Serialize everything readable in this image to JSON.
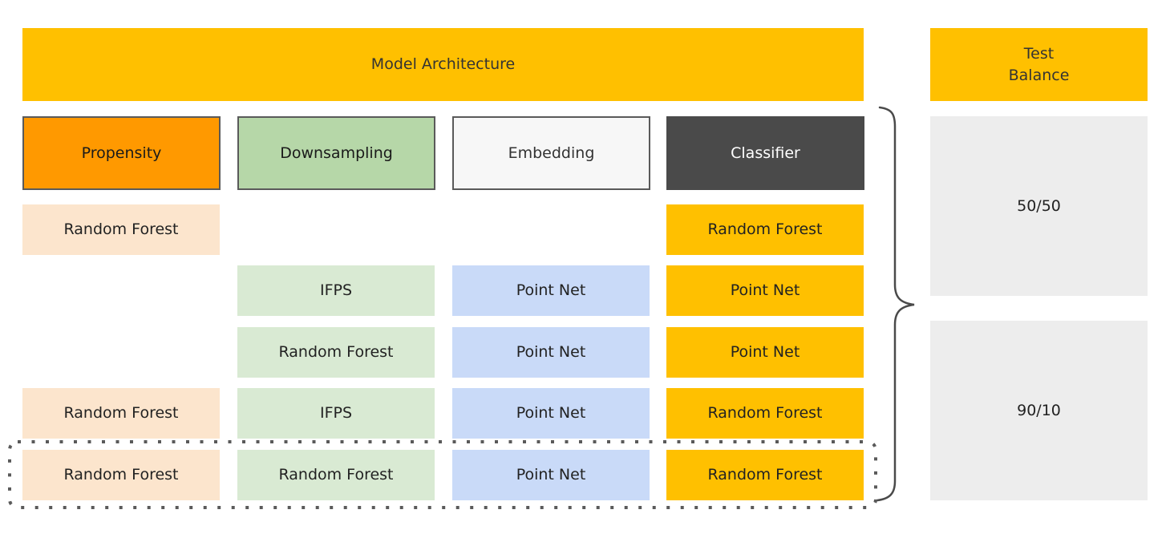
{
  "header": {
    "model_architecture": "Model Architecture",
    "test_balance": "Test\nBalance"
  },
  "columns": [
    {
      "key": "propensity",
      "label": "Propensity",
      "color": "#FF9900",
      "cell_color": "#FCE5CD"
    },
    {
      "key": "downsampling",
      "label": "Downsampling",
      "color": "#B6D7A8",
      "cell_color": "#D9EAD3"
    },
    {
      "key": "embedding",
      "label": "Embedding",
      "color": "#F7F7F7",
      "cell_color": "#C9DAF8"
    },
    {
      "key": "classifier",
      "label": "Classifier",
      "color": "#4A4A4A",
      "cell_color": "#FFC000"
    }
  ],
  "rows": [
    {
      "propensity": "Random Forest",
      "downsampling": "",
      "embedding": "",
      "classifier": "Random Forest"
    },
    {
      "propensity": "",
      "downsampling": "IFPS",
      "embedding": "Point Net",
      "classifier": "Point Net"
    },
    {
      "propensity": "",
      "downsampling": "Random Forest",
      "embedding": "Point Net",
      "classifier": "Point Net"
    },
    {
      "propensity": "Random Forest",
      "downsampling": "IFPS",
      "embedding": "Point Net",
      "classifier": "Random Forest"
    },
    {
      "propensity": "Random Forest",
      "downsampling": "Random Forest",
      "embedding": "Point Net",
      "classifier": "Random Forest",
      "highlighted": true
    }
  ],
  "test_balance": [
    "50/50",
    "90/10"
  ],
  "colors": {
    "header": "#FFC000",
    "balance_bg": "#EDEDED",
    "brace": "#4a4a4a",
    "dotted_outline": "#5a5a5a"
  }
}
